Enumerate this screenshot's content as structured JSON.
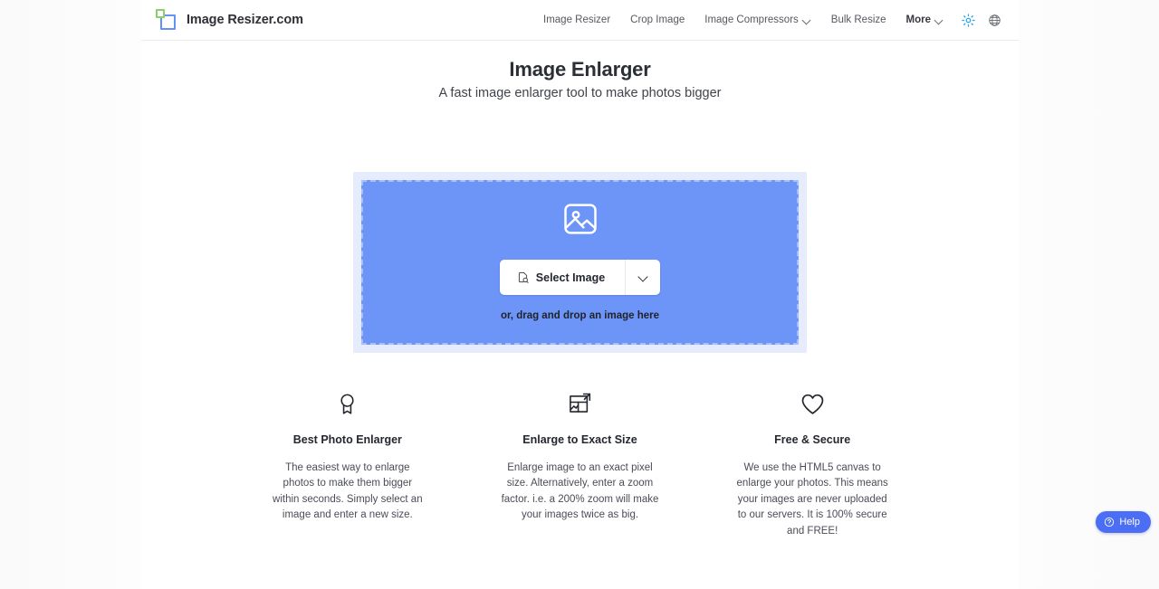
{
  "header": {
    "brand": {
      "name": "Image Resizer.com",
      "logo_icon": "nested-squares-logo-icon"
    },
    "nav": [
      {
        "label": "Image Resizer",
        "has_dropdown": false,
        "bold": false
      },
      {
        "label": "Crop Image",
        "has_dropdown": false,
        "bold": false
      },
      {
        "label": "Image Compressors",
        "has_dropdown": true,
        "bold": false
      },
      {
        "label": "Bulk Resize",
        "has_dropdown": false,
        "bold": false
      },
      {
        "label": "More",
        "has_dropdown": true,
        "bold": true
      }
    ],
    "actions": [
      {
        "icon": "brightness-sun-icon",
        "color": "#27a3ee"
      },
      {
        "icon": "globe-language-icon",
        "color": "#6b6e76"
      }
    ]
  },
  "hero": {
    "title": "Image Enlarger",
    "subtitle": "A fast image enlarger tool to make photos bigger"
  },
  "dropzone": {
    "placeholder_icon": "image-placeholder-icon",
    "select_label": "Select Image",
    "select_icon": "file-image-icon",
    "caret_icon": "chevron-down-icon",
    "drag_text": "or, drag and drop an image here",
    "fill_color": "#6d94f7",
    "border_color": "#a8c0fa",
    "outer_color": "#e6ecfb"
  },
  "features": [
    {
      "icon": "award-ribbon-icon",
      "title": "Best Photo Enlarger",
      "body": "The easiest way to enlarge photos to make them bigger within seconds. Simply select an image and enter a new size."
    },
    {
      "icon": "image-expand-icon",
      "title": "Enlarge to Exact Size",
      "body": "Enlarge image to an exact pixel size. Alternatively, enter a zoom factor. i.e. a 200% zoom will make your images twice as big."
    },
    {
      "icon": "heart-icon",
      "title": "Free & Secure",
      "body": "We use the HTML5 canvas to enlarge your photos. This means your images are never uploaded to our servers. It is 100% secure and FREE!"
    }
  ],
  "help": {
    "label": "Help",
    "icon": "question-circle-icon",
    "color": "#4c6ef5"
  }
}
